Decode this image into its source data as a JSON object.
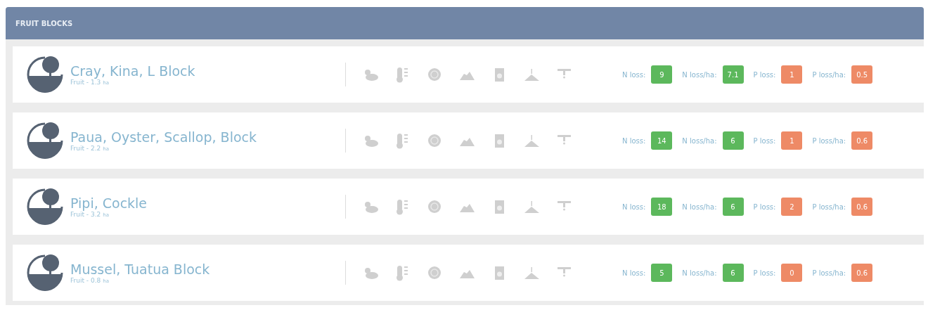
{
  "panel": {
    "title": "FRUIT BLOCKS"
  },
  "blocks": [
    {
      "name": "Cray, Kina, L Block",
      "subtitle": "Fruit - 1.3",
      "unit": "ha",
      "metrics": [
        {
          "label": "N loss:",
          "value": "9",
          "color": "#5cb85c"
        },
        {
          "label": "N loss/ha:",
          "value": "7.1",
          "color": "#5cb85c"
        },
        {
          "label": "P loss:",
          "value": "1",
          "color": "#ee8a66"
        },
        {
          "label": "P loss/ha:",
          "value": "0.5",
          "color": "#ee8a66"
        }
      ]
    },
    {
      "name": "Paua, Oyster, Scallop, Block",
      "subtitle": "Fruit - 2.2",
      "unit": "ha",
      "metrics": [
        {
          "label": "N loss:",
          "value": "14",
          "color": "#5cb85c"
        },
        {
          "label": "N loss/ha:",
          "value": "6",
          "color": "#5cb85c"
        },
        {
          "label": "P loss:",
          "value": "1",
          "color": "#ee8a66"
        },
        {
          "label": "P loss/ha:",
          "value": "0.6",
          "color": "#ee8a66"
        }
      ]
    },
    {
      "name": "Pipi, Cockle",
      "subtitle": "Fruit - 3.2",
      "unit": "ha",
      "metrics": [
        {
          "label": "N loss:",
          "value": "18",
          "color": "#5cb85c"
        },
        {
          "label": "N loss/ha:",
          "value": "6",
          "color": "#5cb85c"
        },
        {
          "label": "P loss:",
          "value": "2",
          "color": "#ee8a66"
        },
        {
          "label": "P loss/ha:",
          "value": "0.6",
          "color": "#ee8a66"
        }
      ]
    },
    {
      "name": "Mussel, Tuatua Block",
      "subtitle": "Fruit - 0.8",
      "unit": "ha",
      "metrics": [
        {
          "label": "N loss:",
          "value": "5",
          "color": "#5cb85c"
        },
        {
          "label": "N loss/ha:",
          "value": "6",
          "color": "#5cb85c"
        },
        {
          "label": "P loss:",
          "value": "0",
          "color": "#ee8a66"
        },
        {
          "label": "P loss/ha:",
          "value": "0.6",
          "color": "#ee8a66"
        }
      ]
    }
  ]
}
